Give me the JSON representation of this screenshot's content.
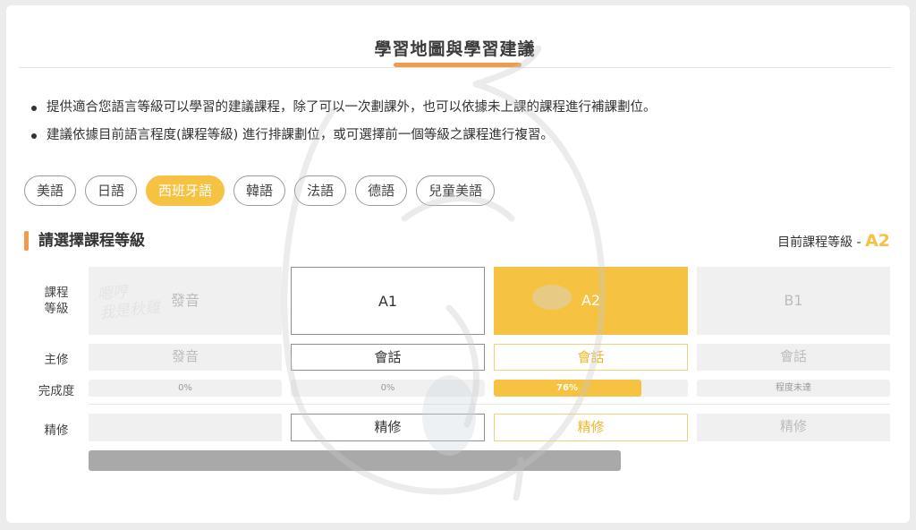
{
  "header": {
    "title": "學習地圖與學習建議"
  },
  "tips": [
    "提供適合您語言等級可以學習的建議課程，除了可以一次劃課外，也可以依據未上課的課程進行補課劃位。",
    "建議依據目前語言程度(課程等級) 進行排課劃位，或可選擇前一個等級之課程進行複習。"
  ],
  "language_tabs": [
    {
      "label": "美語",
      "active": false
    },
    {
      "label": "日語",
      "active": false
    },
    {
      "label": "西班牙語",
      "active": true
    },
    {
      "label": "韓語",
      "active": false
    },
    {
      "label": "法語",
      "active": false
    },
    {
      "label": "德語",
      "active": false
    },
    {
      "label": "兒童美語",
      "active": false
    }
  ],
  "section": {
    "title": "請選擇課程等級",
    "current_level_label": "目前課程等級 - ",
    "current_level_value": "A2"
  },
  "row_labels": {
    "level": "課程\n等級",
    "major": "主修",
    "progress": "完成度",
    "advanced": "精修"
  },
  "levels": [
    {
      "name": "發音",
      "major": "發音",
      "progress_text": "0%",
      "progress": 0,
      "advanced": ""
    },
    {
      "name": "A1",
      "major": "會話",
      "progress_text": "0%",
      "progress": 0,
      "advanced": "精修"
    },
    {
      "name": "A2",
      "major": "會話",
      "progress_text": "76%",
      "progress": 0.76,
      "advanced": "精修"
    },
    {
      "name": "B1",
      "major": "會話",
      "progress_text": "程度未達",
      "progress": 0,
      "advanced": "精修"
    }
  ],
  "watermark": {
    "text": "嗯哼\n我是秋雞"
  },
  "colors": {
    "accent": "#f5c242",
    "orange": "#ef9a4c",
    "disabled": "#f0f0f0"
  }
}
